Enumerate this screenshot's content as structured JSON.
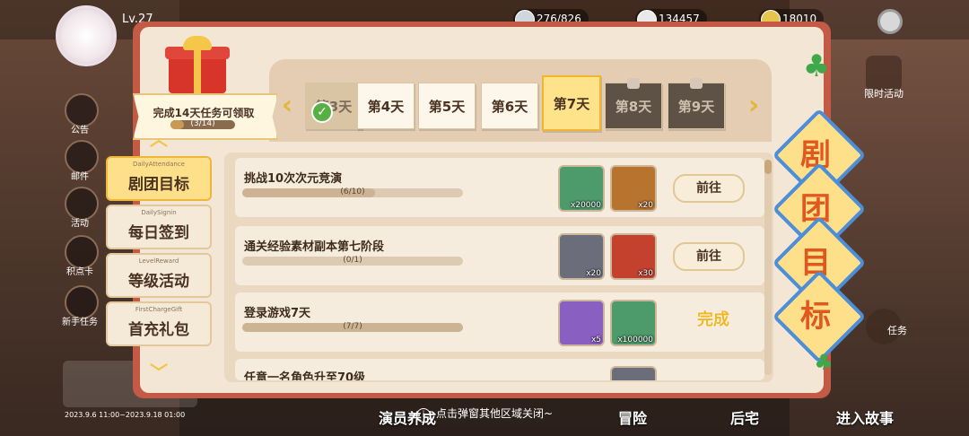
{
  "topbar": {
    "level": "Lv.27",
    "stamina": "276/826",
    "coins": "134457",
    "gems": "18010"
  },
  "left_side_icons": [
    {
      "label": "公告",
      "icon": "announcement-icon"
    },
    {
      "label": "邮件",
      "icon": "mail-icon"
    },
    {
      "label": "活动",
      "icon": "event-icon"
    },
    {
      "label": "积点卡",
      "icon": "points-card-icon"
    },
    {
      "label": "新手任务",
      "icon": "newbie-quest-icon"
    }
  ],
  "right_side": {
    "top_label": "限时活动",
    "bottom_label": "任务"
  },
  "event_banner": {
    "date_range": "2023.9.6 11:00~2023.9.18 01:00"
  },
  "gift": {
    "title": "完成14天任务可领取",
    "count": "(3/14)",
    "progress": 0.21
  },
  "days": [
    {
      "label": "第3天",
      "state": "done"
    },
    {
      "label": "第4天",
      "state": "normal"
    },
    {
      "label": "第5天",
      "state": "normal"
    },
    {
      "label": "第6天",
      "state": "normal"
    },
    {
      "label": "第7天",
      "state": "active"
    },
    {
      "label": "第8天",
      "state": "locked"
    },
    {
      "label": "第9天",
      "state": "locked"
    }
  ],
  "tabs": [
    {
      "sub": "DailyAttendance",
      "label": "剧团目标",
      "active": true
    },
    {
      "sub": "DailySignin",
      "label": "每日签到",
      "active": false
    },
    {
      "sub": "LevelReward",
      "label": "等级活动",
      "active": false
    },
    {
      "sub": "FirstChargeGift",
      "label": "首充礼包",
      "active": false
    }
  ],
  "tasks": [
    {
      "title": "挑战10次次元竞演",
      "count": "(6/10)",
      "progress": 0.6,
      "rewards": [
        {
          "qty": "x20000",
          "color": "#4d9a6a"
        },
        {
          "qty": "x20",
          "color": "#b8732f"
        }
      ],
      "action": "前往",
      "done": false
    },
    {
      "title": "通关经验素材副本第七阶段",
      "count": "(0/1)",
      "progress": 0.0,
      "rewards": [
        {
          "qty": "x20",
          "color": "#6b6e7a"
        },
        {
          "qty": "x30",
          "color": "#c4412e"
        }
      ],
      "action": "前往",
      "done": false
    },
    {
      "title": "登录游戏7天",
      "count": "(7/7)",
      "progress": 1.0,
      "rewards": [
        {
          "qty": "x5",
          "color": "#8a5fc2"
        },
        {
          "qty": "x100000",
          "color": "#4d9a6a"
        }
      ],
      "action": "完成",
      "done": true
    },
    {
      "title": "任意一名角色升至70级",
      "count": "",
      "progress": 0.0,
      "rewards": [
        {
          "qty": "",
          "color": "#6b6e7a"
        }
      ],
      "action": "",
      "done": false
    }
  ],
  "vertical_title": [
    "剧",
    "团",
    "目",
    "标"
  ],
  "hint": "点击弹窗其他区域关闭~",
  "bottom_nav": [
    "演员养成",
    "冒险",
    "后宅",
    "进入故事"
  ],
  "colors": {
    "panel_border": "#c25a46",
    "accent": "#f1b530",
    "done": "#f3b723",
    "title_orange": "#e1581c",
    "badge_blue": "#4c8ed8"
  }
}
